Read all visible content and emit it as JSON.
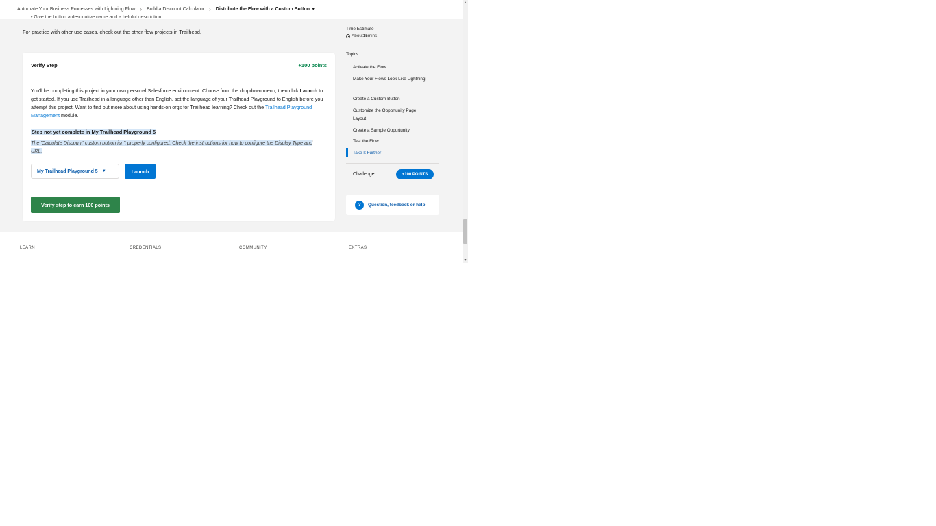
{
  "breadcrumb": {
    "items": [
      "Automate Your Business Processes with Lightning Flow",
      "Build a Discount Calculator"
    ],
    "current": "Distribute the Flow with a Custom Button"
  },
  "content": {
    "cut_text": "• Give the button a descriptive name and a helpful description",
    "practice_pre": "For practice with other use cases, check out the other flow projects in ",
    "practice_link": "Trailhead",
    "practice_post": "."
  },
  "verify": {
    "title": "Verify Step",
    "points": "+100 points",
    "intro_1": "You'll be completing this project in your own personal Salesforce environment. Choose from the dropdown menu, then click ",
    "intro_launch": "Launch",
    "intro_2": " to get started. If you use Trailhead in a language other than English, set the language of your Trailhead Playground to English before you attempt this project. Want to find out more about using hands-on orgs for Trailhead learning? Check out the ",
    "intro_link": "Trailhead Playground Management",
    "intro_3": " module.",
    "status_title": "Step not yet complete in My Trailhead Playground 5",
    "status_message": "The 'Calculate Discount' custom button isn't properly configured. Check the instructions for how to configure the Display Type and URL.",
    "org_selected": "My Trailhead Playground 5",
    "launch_label": "Launch",
    "verify_label": "Verify step to earn 100 points"
  },
  "sidebar": {
    "time_label": "Time Estimate",
    "time_value_pre": "About ",
    "time_value_num": "15",
    "time_value_post": " mins",
    "topics_label": "Topics",
    "topics": [
      "Activate the Flow",
      "Make Your Flows Look Like Lightning",
      "Create a Custom Button",
      "Customize the Opportunity Page Layout",
      "Create a Sample Opportunity",
      "Test the Flow",
      "Take It Further"
    ],
    "challenge_label": "Challenge",
    "challenge_badge": "+100 POINTS",
    "help_text": "Question, feedback or help"
  },
  "footer": {
    "columns": [
      "LEARN",
      "CREDENTIALS",
      "COMMUNITY",
      "EXTRAS"
    ]
  },
  "colors": {
    "accent_blue": "#0176d3",
    "success_green": "#2e844a",
    "points_green": "#04844b",
    "highlight": "#d5e6f7"
  }
}
